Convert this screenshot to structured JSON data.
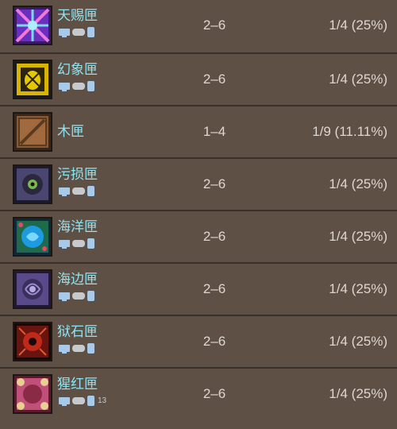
{
  "rows": [
    {
      "name": "天赐匣",
      "qty": "2–6",
      "chance": "1/4 (25%)",
      "icon": "heavenly-crate-icon",
      "platforms": true,
      "badge": ""
    },
    {
      "name": "幻象匣",
      "qty": "2–6",
      "chance": "1/4 (25%)",
      "icon": "mirage-crate-icon",
      "platforms": true,
      "badge": ""
    },
    {
      "name": "木匣",
      "qty": "1–4",
      "chance": "1/9 (11.11%)",
      "icon": "wooden-crate-icon",
      "platforms": false,
      "badge": ""
    },
    {
      "name": "污损匣",
      "qty": "2–6",
      "chance": "1/4 (25%)",
      "icon": "defiled-crate-icon",
      "platforms": true,
      "badge": ""
    },
    {
      "name": "海洋匣",
      "qty": "2–6",
      "chance": "1/4 (25%)",
      "icon": "ocean-crate-icon",
      "platforms": true,
      "badge": ""
    },
    {
      "name": "海边匣",
      "qty": "2–6",
      "chance": "1/4 (25%)",
      "icon": "seaside-crate-icon",
      "platforms": true,
      "badge": ""
    },
    {
      "name": "狱石匣",
      "qty": "2–6",
      "chance": "1/4 (25%)",
      "icon": "hellstone-crate-icon",
      "platforms": true,
      "badge": ""
    },
    {
      "name": "猩红匣",
      "qty": "2–6",
      "chance": "1/4 (25%)",
      "icon": "crimson-crate-icon",
      "platforms": true,
      "badge": "13"
    }
  ]
}
